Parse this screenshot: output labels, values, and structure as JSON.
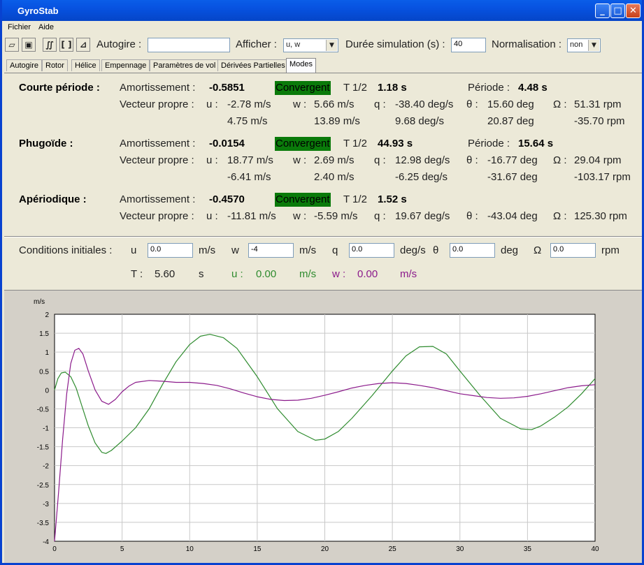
{
  "window": {
    "title": "GyroStab"
  },
  "menu": {
    "file": "Fichier",
    "help": "Aide"
  },
  "toolbar": {
    "icons": [
      "open-folder-icon",
      "save-icon",
      "stability-icon",
      "bracket-icon",
      "axes-icon"
    ],
    "autogire_label": "Autogire :",
    "autogire_value": "",
    "afficher_label": "Afficher :",
    "afficher_value": "u, w",
    "duree_label": "Durée simulation (s) :",
    "duree_value": "40",
    "norm_label": "Normalisation :",
    "norm_value": "non"
  },
  "tabs": [
    "Autogire",
    "Rotor",
    "Hélice",
    "Empennage",
    "Paramètres de vol",
    "Dérivées Partielles",
    "Modes"
  ],
  "active_tab": "Modes",
  "labels": {
    "amort": "Amortissement :",
    "vecteur": "Vecteur propre :",
    "t_half": "T 1/2",
    "periode": "Période :",
    "u": "u :",
    "w": "w :",
    "q": "q :",
    "theta": "θ :",
    "omega": "Ω :"
  },
  "modes": [
    {
      "name": "Courte période :",
      "amortissement": "-0.5851",
      "status": "Convergent",
      "t_half": "1.18 s",
      "periode": "4.48 s",
      "vec": {
        "u": [
          "-2.78 m/s",
          "4.75 m/s"
        ],
        "w": [
          "5.66 m/s",
          "13.89 m/s"
        ],
        "q": [
          "-38.40 deg/s",
          "9.68 deg/s"
        ],
        "theta": [
          "15.60 deg",
          "20.87 deg"
        ],
        "omega": [
          "51.31 rpm",
          "-35.70 rpm"
        ]
      }
    },
    {
      "name": "Phugoïde :",
      "amortissement": "-0.0154",
      "status": "Convergent",
      "t_half": "44.93 s",
      "periode": "15.64 s",
      "vec": {
        "u": [
          "18.77 m/s",
          "-6.41 m/s"
        ],
        "w": [
          "2.69 m/s",
          "2.40 m/s"
        ],
        "q": [
          "12.98 deg/s",
          "-6.25 deg/s"
        ],
        "theta": [
          "-16.77 deg",
          "-31.67 deg"
        ],
        "omega": [
          "29.04 rpm",
          "-103.17 rpm"
        ]
      }
    },
    {
      "name": "Apériodique :",
      "amortissement": "-0.4570",
      "status": "Convergent",
      "t_half": "1.52 s",
      "vec": {
        "u": [
          "-11.81 m/s"
        ],
        "w": [
          "-5.59 m/s"
        ],
        "q": [
          "19.67 deg/s"
        ],
        "theta": [
          "-43.04 deg"
        ],
        "omega": [
          "125.30 rpm"
        ]
      }
    }
  ],
  "initial_conditions": {
    "label": "Conditions initiales :",
    "fields": [
      {
        "name": "u",
        "value": "0.0",
        "unit": "m/s"
      },
      {
        "name": "w",
        "value": "-4",
        "unit": "m/s"
      },
      {
        "name": "q",
        "value": "0.0",
        "unit": "deg/s"
      },
      {
        "name": "θ",
        "value": "0.0",
        "unit": "deg"
      },
      {
        "name": "Ω",
        "value": "0.0",
        "unit": "rpm"
      }
    ],
    "readout": {
      "t_label": "T :",
      "t_value": "5.60",
      "t_unit": "s",
      "u_label": "u :",
      "u_value": "0.00",
      "u_unit": "m/s",
      "w_label": "w :",
      "w_value": "0.00",
      "w_unit": "m/s"
    }
  },
  "colors": {
    "green": "#2e8b2e",
    "purple": "#8b1a8b",
    "convergent_bg": "#0a7a0a"
  },
  "chart_data": {
    "type": "line",
    "ylabel": "m/s",
    "xlim": [
      0,
      40
    ],
    "ylim": [
      -4,
      2
    ],
    "xticks": [
      0,
      5,
      10,
      15,
      20,
      25,
      30,
      35,
      40
    ],
    "yticks": [
      2,
      1.5,
      1,
      0.5,
      0,
      -0.5,
      -1,
      -1.5,
      -2,
      -2.5,
      -3,
      -3.5,
      -4
    ],
    "grid": true,
    "series": [
      {
        "name": "u",
        "color": "#2e8b2e",
        "x": [
          0,
          0.25,
          0.5,
          0.8,
          1.2,
          1.6,
          2.0,
          2.5,
          3.0,
          3.5,
          3.8,
          4.2,
          5.0,
          6.0,
          7.0,
          8.0,
          9.0,
          10.0,
          10.8,
          11.5,
          12.5,
          13.5,
          15.0,
          16.5,
          18.0,
          19.3,
          20.0,
          21.0,
          22.0,
          23.5,
          25.0,
          26.0,
          27.0,
          28.0,
          29.0,
          30.0,
          31.5,
          33.0,
          34.5,
          35.3,
          36.0,
          37.0,
          38.0,
          39.0,
          40.0
        ],
        "y": [
          0,
          0.3,
          0.45,
          0.47,
          0.35,
          0.05,
          -0.4,
          -0.95,
          -1.4,
          -1.65,
          -1.68,
          -1.6,
          -1.35,
          -1.0,
          -0.5,
          0.15,
          0.75,
          1.2,
          1.42,
          1.47,
          1.38,
          1.1,
          0.35,
          -0.5,
          -1.1,
          -1.33,
          -1.3,
          -1.1,
          -0.75,
          -0.15,
          0.5,
          0.9,
          1.14,
          1.15,
          0.95,
          0.5,
          -0.15,
          -0.75,
          -1.03,
          -1.05,
          -0.95,
          -0.72,
          -0.45,
          -0.1,
          0.3
        ]
      },
      {
        "name": "w",
        "color": "#8b1a8b",
        "x": [
          0,
          0.3,
          0.6,
          0.9,
          1.2,
          1.5,
          1.8,
          2.1,
          2.5,
          3.0,
          3.5,
          4.0,
          4.5,
          5.0,
          5.5,
          6.0,
          7.0,
          8.0,
          9.0,
          10.0,
          11.0,
          12.0,
          13.0,
          14.0,
          15.0,
          16.0,
          17.0,
          18.0,
          19.0,
          20.0,
          21.0,
          22.0,
          23.0,
          24.0,
          25.0,
          26.0,
          27.0,
          28.0,
          29.0,
          30.0,
          31.0,
          32.0,
          33.0,
          34.0,
          35.0,
          36.0,
          37.0,
          38.0,
          39.0,
          40.0
        ],
        "y": [
          -4,
          -2.7,
          -1.3,
          -0.1,
          0.7,
          1.05,
          1.1,
          0.95,
          0.5,
          0.0,
          -0.3,
          -0.38,
          -0.25,
          -0.05,
          0.1,
          0.2,
          0.25,
          0.23,
          0.2,
          0.2,
          0.17,
          0.12,
          0.03,
          -0.08,
          -0.18,
          -0.25,
          -0.28,
          -0.27,
          -0.22,
          -0.14,
          -0.05,
          0.05,
          0.12,
          0.17,
          0.19,
          0.17,
          0.12,
          0.06,
          -0.02,
          -0.1,
          -0.15,
          -0.2,
          -0.22,
          -0.21,
          -0.17,
          -0.1,
          -0.02,
          0.06,
          0.11,
          0.14
        ]
      }
    ]
  }
}
